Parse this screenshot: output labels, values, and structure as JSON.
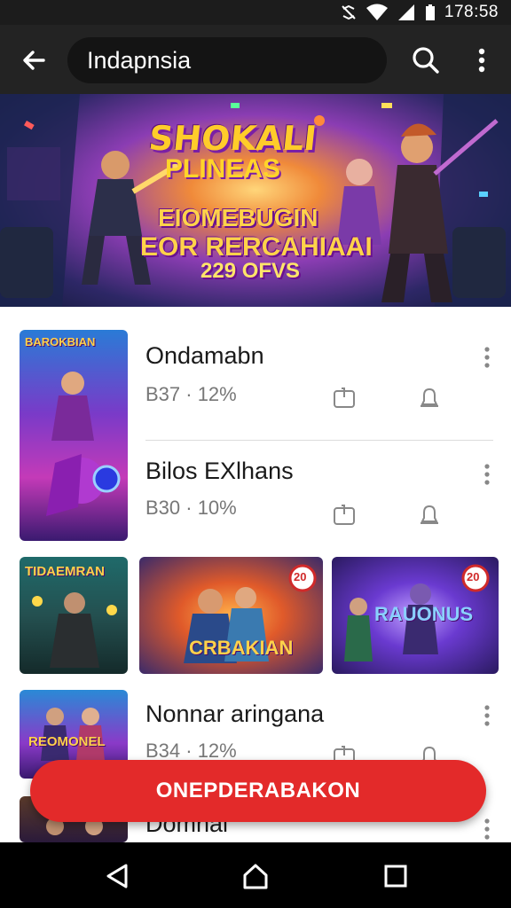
{
  "status_bar": {
    "time": "178:58"
  },
  "app_bar": {
    "search_text": "Indapnsia"
  },
  "banner": {
    "title": "SHOKALI",
    "subtitle": "PLINEAS",
    "line1": "EIOMEBUGIN",
    "line2": "EOR RERCAHIAAI",
    "line3": "229 OFVS"
  },
  "rows": [
    {
      "title": "Ondamabn",
      "subtitle": "B37 · 12%",
      "thumb_label": "BAROKBIAN"
    },
    {
      "title": "Bilos EXlhans",
      "subtitle": "B30 · 10%"
    }
  ],
  "carousel": [
    {
      "label": "TIDAEMRAN"
    },
    {
      "label": "CRBAKIAN",
      "badge": "20"
    },
    {
      "label": "RAUONUS",
      "badge": "20"
    }
  ],
  "rows_lower": [
    {
      "title": "Nonnar aringana",
      "subtitle": "B34 · 12%",
      "thumb_label": "REOMONEL"
    },
    {
      "title": "Domnai"
    }
  ],
  "cta": {
    "label": "ONEPDERABAKON"
  },
  "colors": {
    "accent": "#e32a2a",
    "app_bar": "#232323"
  }
}
